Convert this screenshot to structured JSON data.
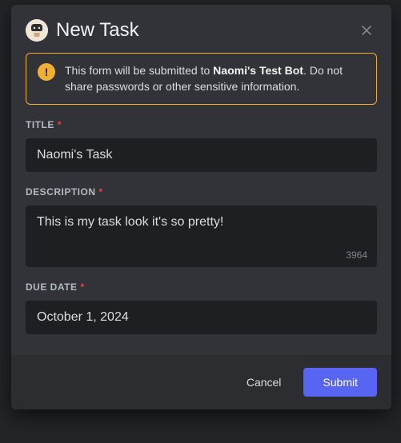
{
  "modal": {
    "title": "New Task"
  },
  "warning": {
    "prefix": "This form will be submitted to ",
    "bot_name": "Naomi's Test Bot",
    "suffix": ". Do not share passwords or other sensitive information."
  },
  "fields": {
    "title": {
      "label": "TITLE",
      "value": "Naomi's Task"
    },
    "description": {
      "label": "DESCRIPTION",
      "value": "This is my task look it's so pretty!",
      "remaining": "3964"
    },
    "due_date": {
      "label": "DUE DATE",
      "value": "October 1, 2024"
    }
  },
  "actions": {
    "cancel": "Cancel",
    "submit": "Submit"
  }
}
